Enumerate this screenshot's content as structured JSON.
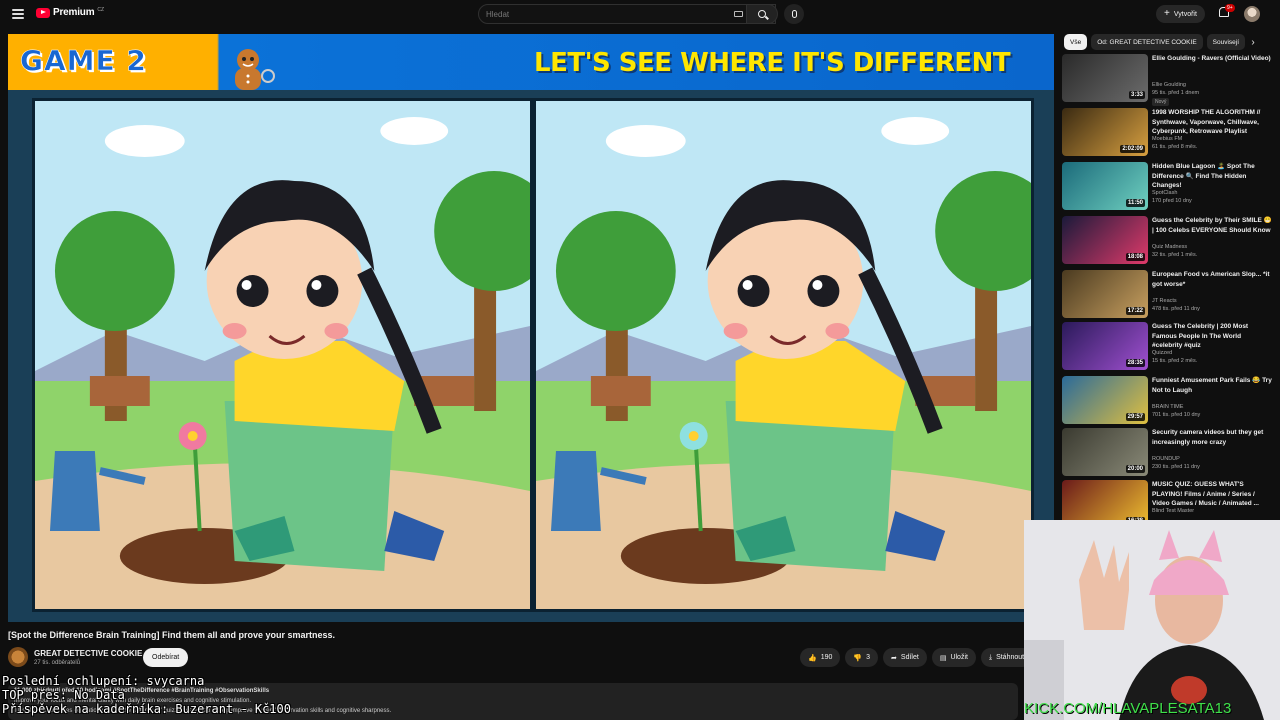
{
  "header": {
    "logo_text": "Premium",
    "logo_cc": "CZ",
    "search_placeholder": "Hledat",
    "create_label": "Vytvořit",
    "notification_count": "9+"
  },
  "video": {
    "banner_game": "GAME 2",
    "banner_title": "LET'S SEE WHERE IT'S DIFFERENT",
    "title": "[Spot the Difference Brain Training] Find them all and prove your smartness.",
    "channel_name": "GREAT DETECTIVE COOKIE",
    "channel_subs": "27 tis. odběratelů",
    "subscribe_label": "Odebírat",
    "likes": "190",
    "dislikes": "3",
    "share_label": "Sdílet",
    "save_label": "Uložit",
    "download_label": "Stáhnout",
    "description_meta": "11 000 zhlédnutí  před 10 hodinami  #SpotTheDifference #BrainTraining #ObservationSkills",
    "description_line1": "Improve your focus and mental clarity with daily brain exercises and cognitive stimulation.",
    "description_line2": "This channel provides educational \"Spot the Difference\" quizzes designed to help improve viewers' observation skills and cognitive sharpness."
  },
  "overlay": {
    "line1": "Poslední ochlupení: svycarna",
    "line2": "TOP přes: No Data",
    "line3": "Příspěvek na kadeřníka: Buzerant - Kč100",
    "kick": "KICK.COM/HLAVAPLESATA13"
  },
  "sidebar": {
    "chips": [
      "Vše",
      "Od: GREAT DETECTIVE COOKIE",
      "Souvisejí"
    ],
    "items": [
      {
        "title": "Ellie Goulding - Ravers (Official Video)",
        "channel": "Ellie Goulding",
        "meta": "95 tis.  před 1 dnem",
        "badge": "Nový",
        "duration": "3:33",
        "thumb_colors": [
          "#2a2a2a",
          "#6c6c6c"
        ]
      },
      {
        "title": "1998 WORSHIP THE ALGORITHM // Synthwave, Vaporwave, Chillwave, Cyberpunk, Retrowave Playlist",
        "channel": "Moebius FM",
        "meta": "61 tis.  před 8 měs.",
        "badge": "",
        "duration": "2:02:09",
        "thumb_colors": [
          "#3a2a12",
          "#d8a040"
        ]
      },
      {
        "title": "Hidden Blue Lagoon 🏝️ Spot The Difference 🔍 Find The Hidden Changes!",
        "channel": "SpotClash",
        "meta": "170  před 10 dny",
        "badge": "",
        "duration": "11:50",
        "thumb_colors": [
          "#1b6a7a",
          "#6fd0c0"
        ]
      },
      {
        "title": "Guess the Celebrity by Their SMILE 😁 | 100 Celebs EVERYONE Should Know",
        "channel": "Quiz Madness",
        "meta": "32 tis.  před 1 měs.",
        "badge": "",
        "duration": "18:08",
        "thumb_colors": [
          "#1a1a3a",
          "#e03a6a"
        ]
      },
      {
        "title": "European Food vs American Slop... *it got worse*",
        "channel": "JT Reacts",
        "meta": "478 tis.  před 11 dny",
        "badge": "",
        "duration": "17:22",
        "thumb_colors": [
          "#4a3a20",
          "#c8a060"
        ]
      },
      {
        "title": "Guess The Celebrity | 200 Most Famous People In The World #celebrity #quiz",
        "channel": "Quizzed",
        "meta": "15 tis.  před 2 měs.",
        "badge": "",
        "duration": "28:35",
        "thumb_colors": [
          "#2a1a5a",
          "#a050d0"
        ]
      },
      {
        "title": "Funniest Amusement Park Fails 😂 Try Not to Laugh",
        "channel": "BRAIN TIME",
        "meta": "701 tis.  před 10 dny",
        "badge": "",
        "duration": "29:57",
        "thumb_colors": [
          "#2a6a9a",
          "#e0c040"
        ]
      },
      {
        "title": "Security camera videos but they get increasingly more crazy",
        "channel": "ROUNDUP",
        "meta": "230 tis.  před 11 dny",
        "badge": "",
        "duration": "20:00",
        "thumb_colors": [
          "#3a3a30",
          "#8a8a78"
        ]
      },
      {
        "title": "MUSIC QUIZ: GUESS WHAT'S PLAYING! Films / Anime / Series / Video Games / Music / Animated ...",
        "channel": "Blind Test Master",
        "meta": "",
        "badge": "",
        "duration": "16:28",
        "thumb_colors": [
          "#6a1a1a",
          "#f0c030"
        ]
      }
    ]
  },
  "colors": {
    "accent": "#ff0033",
    "banner_blue": "#0a66cc",
    "banner_yellow": "#ffe600",
    "kick_green": "#3fe04a"
  }
}
